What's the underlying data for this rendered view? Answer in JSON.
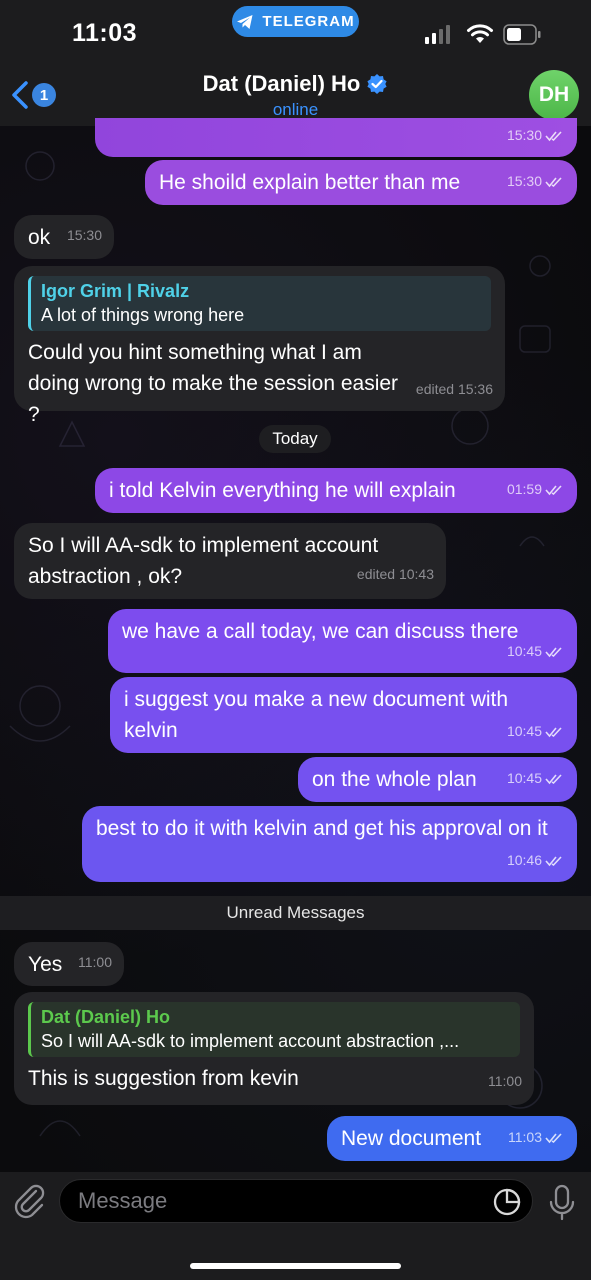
{
  "status_bar": {
    "time": "11:03",
    "app_pill": "TELEGRAM"
  },
  "header": {
    "back_count": "1",
    "title": "Dat (Daniel) Ho",
    "status": "online",
    "avatar_initials": "DH"
  },
  "messages": [
    {
      "dir": "out",
      "text": "",
      "time": "15:30",
      "read": true
    },
    {
      "dir": "out",
      "text": "He shoild explain better than me",
      "time": "15:30",
      "read": true
    },
    {
      "dir": "in",
      "text": "ok",
      "time": "15:30"
    },
    {
      "dir": "in",
      "reply_author": "Igor Grim | Rivalz",
      "reply_text": "A lot of things wrong here",
      "text": "Could you hint something what I am doing wrong to make the session easier ?",
      "time": "edited 15:36"
    },
    {
      "dir": "out",
      "text": "i told Kelvin everything he will explain",
      "time": "01:59",
      "read": true
    },
    {
      "dir": "in",
      "text": "So I will AA-sdk to implement account abstraction , ok?",
      "time": "edited 10:43"
    },
    {
      "dir": "out",
      "text": "we have a call today, we can discuss there",
      "time": "10:45",
      "read": true
    },
    {
      "dir": "out",
      "text": "i suggest you make a new document with kelvin",
      "time": "10:45",
      "read": true
    },
    {
      "dir": "out",
      "text": "on the whole plan",
      "time": "10:45",
      "read": true
    },
    {
      "dir": "out",
      "text": "best to do it with kelvin and get his approval on it",
      "time": "10:46",
      "read": true
    },
    {
      "dir": "in",
      "text": "Yes",
      "time": "11:00"
    },
    {
      "dir": "in",
      "reply_author": "Dat (Daniel) Ho",
      "reply_text": "So I will AA-sdk to implement account abstraction ,...",
      "text": "This is suggestion from kevin",
      "time": "11:00"
    },
    {
      "dir": "out",
      "text": "New document",
      "time": "11:03",
      "read": true
    }
  ],
  "date_divider": "Today",
  "unread_divider": "Unread Messages",
  "composer": {
    "placeholder": "Message"
  },
  "colors": {
    "accent": "#3a92ff",
    "bubble_out_top": "#9d4fe0",
    "bubble_out_bottom": "#3f6bf0",
    "bubble_in": "#242427",
    "reply_rivalz": "#4fd1e8",
    "reply_dat": "#5cc94d",
    "avatar": "#56be50"
  },
  "icons": [
    "back-chevron-icon",
    "telegram-plane-icon",
    "verified-icon",
    "read-checks-icon",
    "attach-icon",
    "sticker-icon",
    "mic-icon",
    "signal-icon",
    "wifi-icon",
    "battery-icon"
  ]
}
